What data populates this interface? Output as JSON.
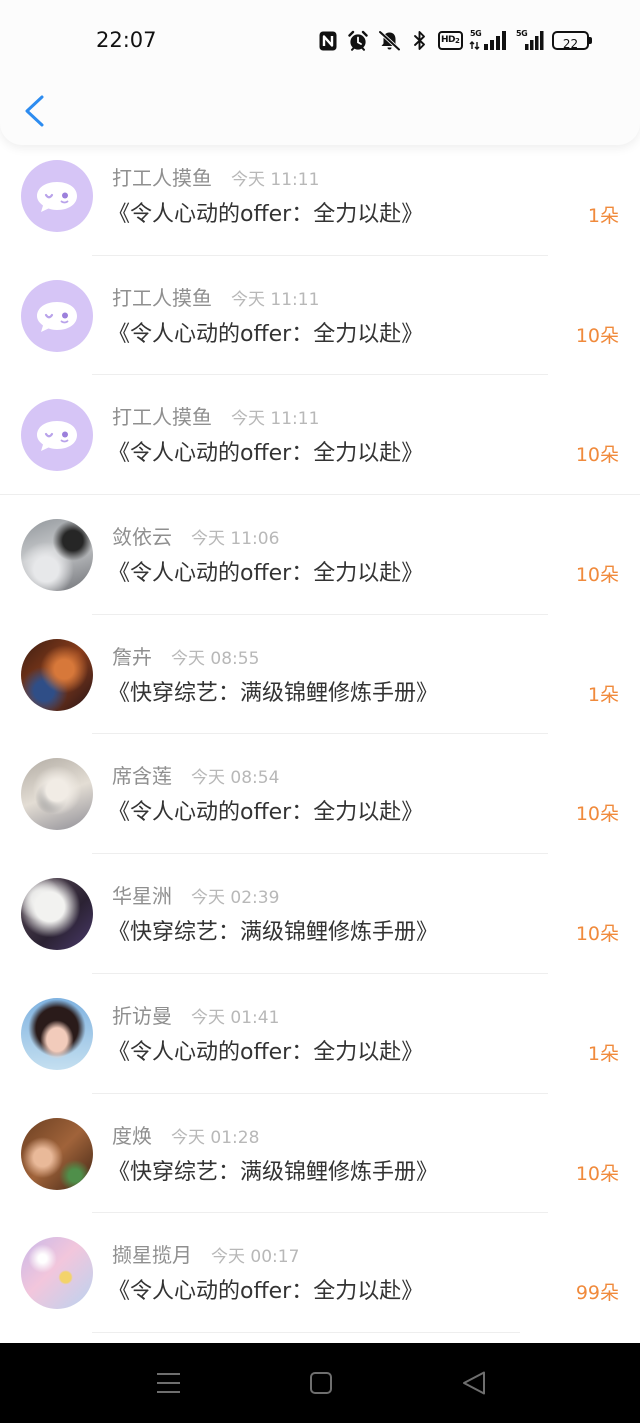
{
  "status_bar": {
    "time": "22:07",
    "icons": [
      "nfc-icon",
      "alarm-icon",
      "mute-icon",
      "bluetooth-icon",
      "hd-voice-icon",
      "signal-5g-icon",
      "signal-5g-icon",
      "battery-icon"
    ],
    "hd_label": "HD",
    "hd_sub": "2",
    "sim1_label": "5G",
    "sim2_label": "5G",
    "battery_level": "22"
  },
  "header": {
    "back_icon": "chevron-left-icon"
  },
  "colors": {
    "accent_orange": "#f08a3c",
    "back_blue": "#2d8cf0",
    "avatar_lavender": "#d6c5f6",
    "name_gray": "#8f8f8f",
    "time_gray": "#b8b8b8",
    "title_dark": "#333333",
    "nav_bar_bg": "#000000"
  },
  "gifts": [
    {
      "user": "打工人摸鱼",
      "time": "今天 11:11",
      "book": "《令人心动的offer：全力以赴》",
      "amount": "1朵",
      "avatar_icon": "chat-bubble-icon"
    },
    {
      "user": "打工人摸鱼",
      "time": "今天 11:11",
      "book": "《令人心动的offer：全力以赴》",
      "amount": "10朵",
      "avatar_icon": "chat-bubble-icon"
    },
    {
      "user": "打工人摸鱼",
      "time": "今天 11:11",
      "book": "《令人心动的offer：全力以赴》",
      "amount": "10朵",
      "avatar_icon": "chat-bubble-icon"
    },
    {
      "user": "敛依云",
      "time": "今天 11:06",
      "book": "《令人心动的offer：全力以赴》",
      "amount": "10朵"
    },
    {
      "user": "詹卉",
      "time": "今天 08:55",
      "book": "《快穿综艺：满级锦鲤修炼手册》",
      "amount": "1朵"
    },
    {
      "user": "席含莲",
      "time": "今天 08:54",
      "book": "《令人心动的offer：全力以赴》",
      "amount": "10朵"
    },
    {
      "user": "华星洲",
      "time": "今天 02:39",
      "book": "《快穿综艺：满级锦鲤修炼手册》",
      "amount": "10朵"
    },
    {
      "user": "折访曼",
      "time": "今天 01:41",
      "book": "《令人心动的offer：全力以赴》",
      "amount": "1朵"
    },
    {
      "user": "度焕",
      "time": "今天 01:28",
      "book": "《快穿综艺：满级锦鲤修炼手册》",
      "amount": "10朵"
    },
    {
      "user": "撷星揽月",
      "time": "今天 00:17",
      "book": "《令人心动的offer：全力以赴》",
      "amount": "99朵"
    }
  ],
  "nav_bar": {
    "icons": [
      "menu-icon",
      "home-icon",
      "back-triangle-icon"
    ]
  }
}
